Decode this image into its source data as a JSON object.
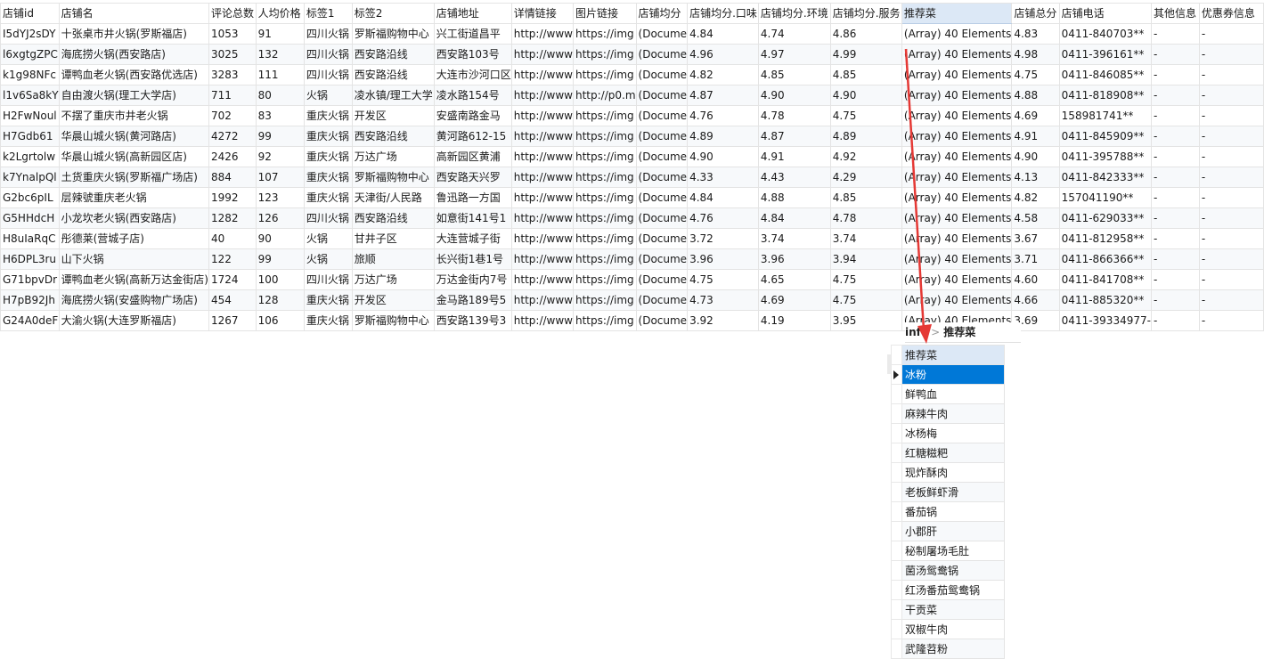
{
  "columns": [
    "店铺id",
    "店铺名",
    "评论总数",
    "人均价格",
    "标签1",
    "标签2",
    "店铺地址",
    "详情链接",
    "图片链接",
    "店铺均分",
    "店铺均分.口味",
    "店铺均分.环境",
    "店铺均分.服务",
    "推荐菜",
    "店铺总分",
    "店铺电话",
    "其他信息",
    "优惠券信息"
  ],
  "rows": [
    [
      "I5dYJ2sDY",
      "十张桌市井火锅(罗斯福店)",
      "1053",
      "91",
      "四川火锅",
      "罗斯福购物中心",
      "兴工街道昌平",
      "http://www",
      "https://img",
      "(Docume",
      "4.84",
      "4.74",
      "4.86",
      "(Array) 40 Elements",
      "4.83",
      "0411-840703**",
      "-",
      "-"
    ],
    [
      "l6xgtgZPC",
      "海底捞火锅(西安路店)",
      "3025",
      "132",
      "四川火锅",
      "西安路沿线",
      "西安路103号",
      "http://www",
      "https://img",
      "(Docume",
      "4.96",
      "4.97",
      "4.99",
      "(Array) 40 Elements",
      "4.98",
      "0411-396161**",
      "-",
      "-"
    ],
    [
      "k1g98NFc",
      "谭鸭血老火锅(西安路优选店)",
      "3283",
      "111",
      "四川火锅",
      "西安路沿线",
      "大连市沙河口区",
      "http://www",
      "https://img",
      "(Docume",
      "4.82",
      "4.85",
      "4.85",
      "(Array) 40 Elements",
      "4.75",
      "0411-846085**",
      "-",
      "-"
    ],
    [
      "l1v6Sa8kY",
      "自由渡火锅(理工大学店)",
      "711",
      "80",
      "火锅",
      "凌水镇/理工大学",
      "凌水路154号",
      "http://www",
      "http://p0.m",
      "(Docume",
      "4.87",
      "4.90",
      "4.90",
      "(Array) 40 Elements",
      "4.88",
      "0411-818908**",
      "-",
      "-"
    ],
    [
      "H2FwNoul",
      "不摆了重庆市井老火锅",
      "702",
      "83",
      "重庆火锅",
      "开发区",
      "安盛南路金马",
      "http://www",
      "https://img",
      "(Docume",
      "4.76",
      "4.78",
      "4.75",
      "(Array) 40 Elements",
      "4.69",
      "158981741**",
      "-",
      "-"
    ],
    [
      "H7Gdb61",
      "华晨山城火锅(黄河路店)",
      "4272",
      "99",
      "重庆火锅",
      "西安路沿线",
      "黄河路612-15",
      "http://www",
      "https://img",
      "(Docume",
      "4.89",
      "4.87",
      "4.89",
      "(Array) 40 Elements",
      "4.91",
      "0411-845909**",
      "-",
      "-"
    ],
    [
      "k2Lgrtolw",
      "华晨山城火锅(高新园区店)",
      "2426",
      "92",
      "重庆火锅",
      "万达广场",
      "高新园区黄浦",
      "http://www",
      "https://img",
      "(Docume",
      "4.90",
      "4.91",
      "4.92",
      "(Array) 40 Elements",
      "4.90",
      "0411-395788**",
      "-",
      "-"
    ],
    [
      "k7YnalpQl",
      "土货重庆火锅(罗斯福广场店)",
      "884",
      "107",
      "重庆火锅",
      "罗斯福购物中心",
      "西安路天兴罗",
      "http://www",
      "https://img",
      "(Docume",
      "4.33",
      "4.43",
      "4.29",
      "(Array) 40 Elements",
      "4.13",
      "0411-842333**",
      "-",
      "-"
    ],
    [
      "G2bc6pIL",
      "层辣號重庆老火锅",
      "1992",
      "123",
      "重庆火锅",
      "天津街/人民路",
      "鲁迅路一方国",
      "http://www",
      "https://img",
      "(Docume",
      "4.84",
      "4.88",
      "4.85",
      "(Array) 40 Elements",
      "4.82",
      "157041190**",
      "-",
      "-"
    ],
    [
      "G5HHdcH",
      "小龙坎老火锅(西安路店)",
      "1282",
      "126",
      "四川火锅",
      "西安路沿线",
      "如意街141号1",
      "http://www",
      "https://img",
      "(Docume",
      "4.76",
      "4.84",
      "4.78",
      "(Array) 40 Elements",
      "4.58",
      "0411-629033**",
      "-",
      "-"
    ],
    [
      "H8uIaRqC",
      "彤德莱(营城子店)",
      "40",
      "90",
      "火锅",
      "甘井子区",
      "大连营城子街",
      "http://www",
      "https://img",
      "(Docume",
      "3.72",
      "3.74",
      "3.74",
      "(Array) 40 Elements",
      "3.67",
      "0411-812958**",
      "-",
      "-"
    ],
    [
      "H6DPL3ru",
      "山下火锅",
      "122",
      "99",
      "火锅",
      "旅顺",
      "长兴街1巷1号",
      "http://www",
      "https://img",
      "(Docume",
      "3.96",
      "3.96",
      "3.94",
      "(Array) 40 Elements",
      "3.71",
      "0411-866366**",
      "-",
      "-"
    ],
    [
      "G71bpvDr",
      "谭鸭血老火锅(高新万达金街店)",
      "1724",
      "100",
      "四川火锅",
      "万达广场",
      "万达金街内7号",
      "http://www",
      "https://img",
      "(Docume",
      "4.75",
      "4.65",
      "4.75",
      "(Array) 40 Elements",
      "4.60",
      "0411-841708**",
      "-",
      "-"
    ],
    [
      "H7pB92Jh",
      "海底捞火锅(安盛购物广场店)",
      "454",
      "128",
      "重庆火锅",
      "开发区",
      "金马路189号5",
      "http://www",
      "https://img",
      "(Docume",
      "4.73",
      "4.69",
      "4.75",
      "(Array) 40 Elements",
      "4.66",
      "0411-885320**",
      "-",
      "-"
    ],
    [
      "G24A0deF",
      "大渝火锅(大连罗斯福店)",
      "1267",
      "106",
      "重庆火锅",
      "罗斯福购物中心",
      "西安路139号3",
      "http://www",
      "https://img",
      "(Docume",
      "3.92",
      "4.19",
      "3.95",
      "(Array) 40 Elements",
      "3.69",
      "0411-39334977-",
      "-",
      "-"
    ]
  ],
  "selected_column": "推荐菜",
  "detail": {
    "crumb_root": "info",
    "crumb_sep": ">",
    "crumb_leaf": "推荐菜",
    "header": "推荐菜",
    "items": [
      "冰粉",
      "鲜鸭血",
      "麻辣牛肉",
      "冰杨梅",
      "红糖糍粑",
      "现炸酥肉",
      "老板鲜虾滑",
      "番茄锅",
      "小郡肝",
      "秘制屠场毛肚",
      "菌汤鸳鸯锅",
      "红汤番茄鸳鸯锅",
      "干贡菜",
      "双椒牛肉",
      "武隆苕粉"
    ],
    "active_index": 0
  },
  "colors": {
    "header_selected": "#dce8f6",
    "row_selected": "#0078d7",
    "arrow": "#e53935",
    "grid_line": "#e4e4e4"
  }
}
